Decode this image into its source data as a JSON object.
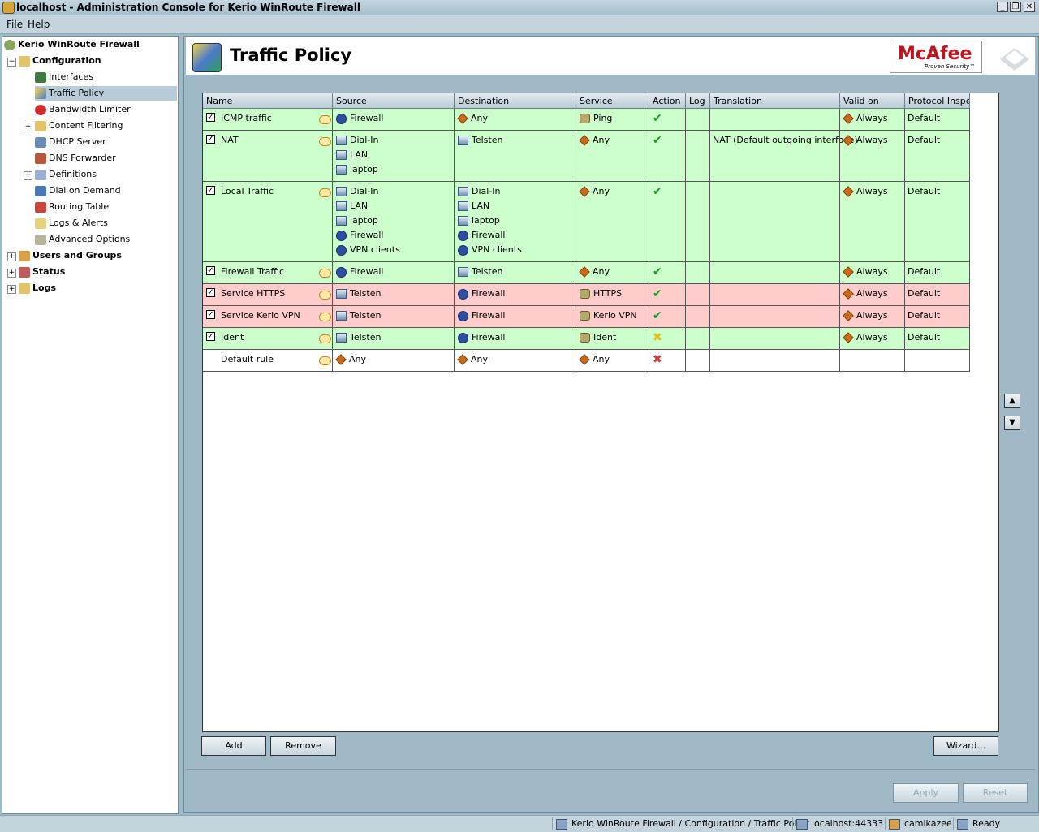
{
  "window": {
    "title": "localhost - Administration Console for Kerio WinRoute Firewall"
  },
  "menu": [
    "File",
    "Help"
  ],
  "tree": {
    "root": "Kerio WinRoute Firewall",
    "configuration": "Configuration",
    "items": [
      "Interfaces",
      "Traffic Policy",
      "Bandwidth Limiter",
      "Content Filtering",
      "DHCP Server",
      "DNS Forwarder",
      "Definitions",
      "Dial on Demand",
      "Routing Table",
      "Logs & Alerts",
      "Advanced Options"
    ],
    "users": "Users and Groups",
    "status": "Status",
    "logs": "Logs",
    "selected": "Traffic Policy"
  },
  "header": {
    "title": "Traffic Policy",
    "brand": "McAfee",
    "brand_tagline": "Proven Security™"
  },
  "columns": [
    "Name",
    "Source",
    "Destination",
    "Service",
    "Action",
    "Log",
    "Translation",
    "Valid on",
    "Protocol Inspec"
  ],
  "rules": [
    {
      "name": "ICMP traffic",
      "enabled": true,
      "color": "green",
      "source": [
        "Firewall"
      ],
      "destination": [
        "Any"
      ],
      "service": [
        "Ping"
      ],
      "action": "permit",
      "log": "",
      "translation": "",
      "valid_on": "Always",
      "protocol": "Default"
    },
    {
      "name": "NAT",
      "enabled": true,
      "color": "green",
      "source": [
        "Dial-In",
        "LAN",
        "laptop"
      ],
      "destination": [
        "Telsten"
      ],
      "service": [
        "Any"
      ],
      "action": "permit",
      "log": "",
      "translation": "NAT (Default outgoing interface)",
      "valid_on": "Always",
      "protocol": "Default"
    },
    {
      "name": "Local Traffic",
      "enabled": true,
      "color": "green",
      "source": [
        "Dial-In",
        "LAN",
        "laptop",
        "Firewall",
        "VPN clients"
      ],
      "destination": [
        "Dial-In",
        "LAN",
        "laptop",
        "Firewall",
        "VPN clients"
      ],
      "service": [
        "Any"
      ],
      "action": "permit",
      "log": "",
      "translation": "",
      "valid_on": "Always",
      "protocol": "Default"
    },
    {
      "name": "Firewall Traffic",
      "enabled": true,
      "color": "green",
      "source": [
        "Firewall"
      ],
      "destination": [
        "Telsten"
      ],
      "service": [
        "Any"
      ],
      "action": "permit",
      "log": "",
      "translation": "",
      "valid_on": "Always",
      "protocol": "Default"
    },
    {
      "name": "Service HTTPS",
      "enabled": true,
      "color": "red",
      "source": [
        "Telsten"
      ],
      "destination": [
        "Firewall"
      ],
      "service": [
        "HTTPS"
      ],
      "action": "permit",
      "log": "",
      "translation": "",
      "valid_on": "Always",
      "protocol": "Default"
    },
    {
      "name": "Service Kerio VPN",
      "enabled": true,
      "color": "red",
      "source": [
        "Telsten"
      ],
      "destination": [
        "Firewall"
      ],
      "service": [
        "Kerio VPN"
      ],
      "action": "permit",
      "log": "",
      "translation": "",
      "valid_on": "Always",
      "protocol": "Default"
    },
    {
      "name": "Ident",
      "enabled": true,
      "color": "green",
      "source": [
        "Telsten"
      ],
      "destination": [
        "Firewall"
      ],
      "service": [
        "Ident"
      ],
      "action": "drop",
      "log": "",
      "translation": "",
      "valid_on": "Always",
      "protocol": "Default"
    },
    {
      "name": "Default rule",
      "enabled": false,
      "color": "white",
      "source": [
        "Any"
      ],
      "destination": [
        "Any"
      ],
      "service": [
        "Any"
      ],
      "action": "deny",
      "log": "",
      "translation": "",
      "valid_on": "",
      "protocol": ""
    }
  ],
  "buttons": {
    "add": "Add",
    "remove": "Remove",
    "wizard": "Wizard...",
    "apply": "Apply",
    "reset": "Reset"
  },
  "statusbar": {
    "path": "Kerio WinRoute Firewall / Configuration / Traffic Policy",
    "server": "localhost:44333",
    "user": "camikazee",
    "state": "Ready"
  }
}
